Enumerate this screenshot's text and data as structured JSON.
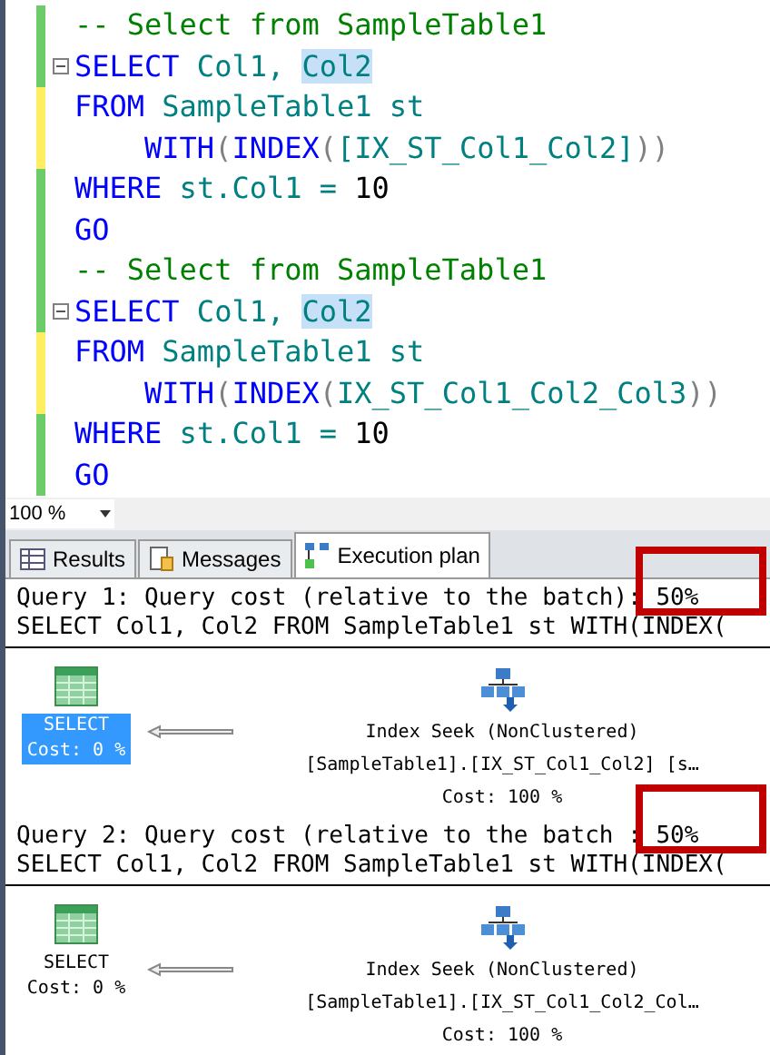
{
  "editor": {
    "lines": [
      {
        "fold": false,
        "unsaved": false,
        "tokens": [
          {
            "kind": "comment",
            "text": "-- Select from SampleTable1"
          }
        ]
      },
      {
        "fold": true,
        "unsaved": false,
        "tokens": [
          {
            "kind": "keyword",
            "text": "SELECT"
          },
          {
            "kind": "ident",
            "text": " Col1, "
          },
          {
            "kind": "ident",
            "text": "Col2",
            "highlighted": true
          }
        ]
      },
      {
        "fold": false,
        "unsaved": true,
        "tokens": [
          {
            "kind": "keyword",
            "text": "FROM"
          },
          {
            "kind": "ident",
            "text": " SampleTable1 st"
          }
        ]
      },
      {
        "fold": false,
        "unsaved": true,
        "tokens": [
          {
            "kind": "keyword",
            "text": "    WITH"
          },
          {
            "kind": "paren",
            "text": "("
          },
          {
            "kind": "keyword",
            "text": "INDEX"
          },
          {
            "kind": "paren",
            "text": "("
          },
          {
            "kind": "ident",
            "text": "[IX_ST_Col1_Col2]"
          },
          {
            "kind": "paren",
            "text": "))"
          }
        ]
      },
      {
        "fold": false,
        "unsaved": false,
        "tokens": [
          {
            "kind": "keyword",
            "text": "WHERE"
          },
          {
            "kind": "ident",
            "text": " st.Col1 = "
          },
          {
            "kind": "number",
            "text": "10"
          }
        ]
      },
      {
        "fold": false,
        "unsaved": false,
        "tokens": [
          {
            "kind": "keyword",
            "text": "GO"
          }
        ]
      },
      {
        "fold": false,
        "unsaved": false,
        "tokens": [
          {
            "kind": "comment",
            "text": "-- Select from SampleTable1"
          }
        ]
      },
      {
        "fold": true,
        "unsaved": false,
        "tokens": [
          {
            "kind": "keyword",
            "text": "SELECT"
          },
          {
            "kind": "ident",
            "text": " Col1, "
          },
          {
            "kind": "ident",
            "text": "Col2",
            "highlighted": true
          }
        ]
      },
      {
        "fold": false,
        "unsaved": true,
        "tokens": [
          {
            "kind": "keyword",
            "text": "FROM"
          },
          {
            "kind": "ident",
            "text": " SampleTable1 st"
          }
        ]
      },
      {
        "fold": false,
        "unsaved": true,
        "tokens": [
          {
            "kind": "keyword",
            "text": "    WITH"
          },
          {
            "kind": "paren",
            "text": "("
          },
          {
            "kind": "keyword",
            "text": "INDEX"
          },
          {
            "kind": "paren",
            "text": "("
          },
          {
            "kind": "ident",
            "text": "IX_ST_Col1_Col2_Col3"
          },
          {
            "kind": "paren",
            "text": "))"
          }
        ]
      },
      {
        "fold": false,
        "unsaved": false,
        "tokens": [
          {
            "kind": "keyword",
            "text": "WHERE"
          },
          {
            "kind": "ident",
            "text": " st.Col1 = "
          },
          {
            "kind": "number",
            "text": "10"
          }
        ]
      },
      {
        "fold": false,
        "unsaved": false,
        "tokens": [
          {
            "kind": "keyword",
            "text": "GO"
          }
        ]
      }
    ]
  },
  "zoom": "100 %",
  "tabs": [
    {
      "label": "Results",
      "selected": false
    },
    {
      "label": "Messages",
      "selected": false
    },
    {
      "label": "Execution plan",
      "selected": true
    }
  ],
  "queries": [
    {
      "header": "Query 1: Query cost (relative to the batch): 50%",
      "statement": "SELECT Col1, Col2 FROM SampleTable1 st WITH(INDEX(",
      "select_node": {
        "label": "SELECT",
        "cost": "Cost: 0 %",
        "selected": true
      },
      "seek_node": {
        "label": "Index Seek (NonClustered)",
        "object": "[SampleTable1].[IX_ST_Col1_Col2] [s…",
        "cost": "Cost: 100 %"
      }
    },
    {
      "header": "Query 2: Query cost (relative to the batch : 50%",
      "statement": "SELECT Col1, Col2 FROM SampleTable1 st WITH(INDEX(",
      "select_node": {
        "label": "SELECT",
        "cost": "Cost: 0 %",
        "selected": false
      },
      "seek_node": {
        "label": "Index Seek (NonClustered)",
        "object": "[SampleTable1].[IX_ST_Col1_Col2_Col…",
        "cost": "Cost: 100 %"
      }
    }
  ]
}
